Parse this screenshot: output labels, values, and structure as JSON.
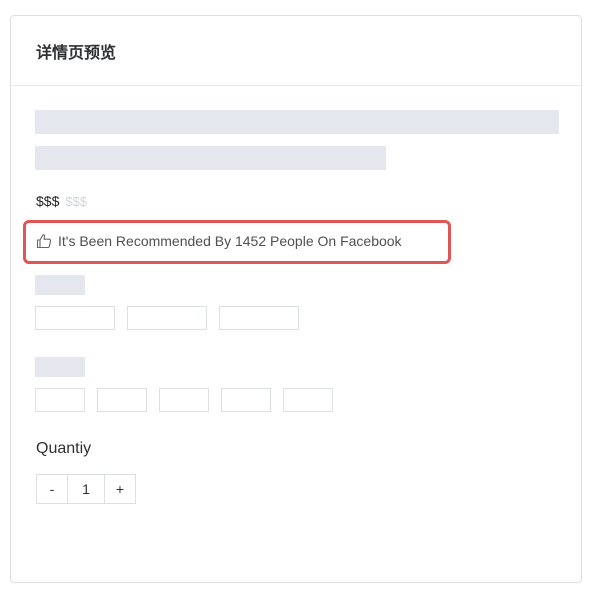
{
  "card": {
    "title": "详情页预览"
  },
  "price": {
    "main": "$$$",
    "compare": "$$$"
  },
  "recommendation": {
    "icon": "thumbs-up-icon",
    "text": "It's Been Recommended By 1452 People On Facebook"
  },
  "quantity": {
    "label": "Quantiy",
    "decrement": "-",
    "value": "1",
    "increment": "+"
  },
  "colors": {
    "highlight": "#e05555",
    "skeleton": "#e4e8ee",
    "border": "#dcdfe6"
  }
}
